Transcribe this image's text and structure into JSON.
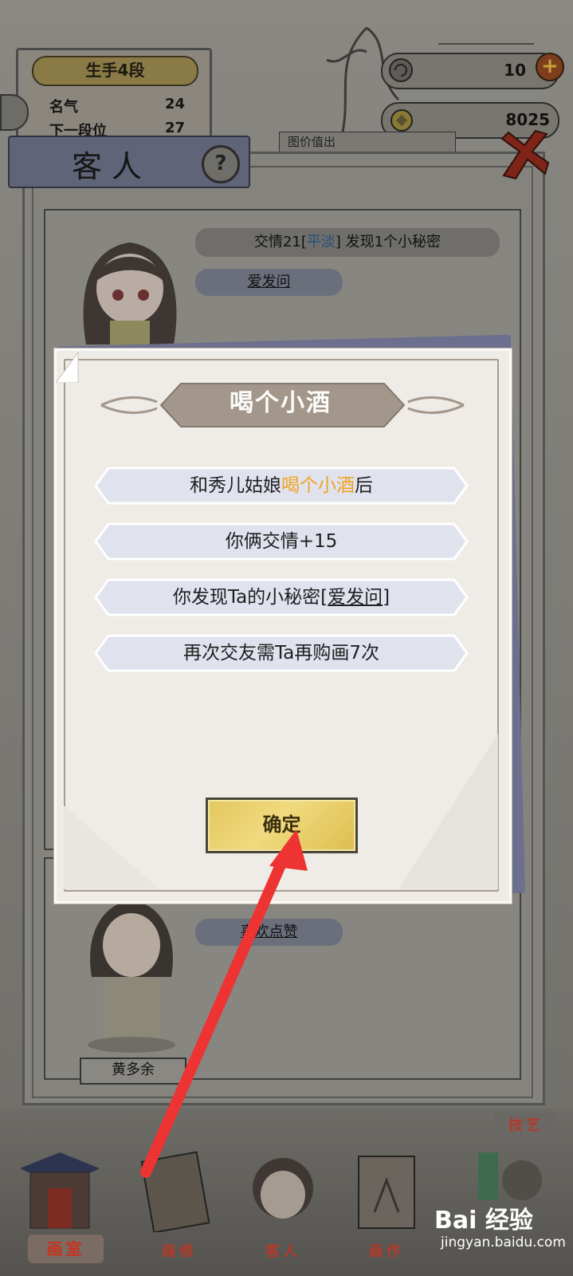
{
  "rank": {
    "title": "生手4段",
    "fame_label": "名气",
    "fame_value": "24",
    "next_label": "下一段位",
    "next_value": "27"
  },
  "currency": {
    "tokens": "10",
    "coins": "8025",
    "notice": "图价值出"
  },
  "guest_panel": {
    "title": "客人",
    "help_glyph": "?",
    "guests": [
      {
        "relation_prefix": "交情21[",
        "relation_status": "平淡",
        "relation_suffix": "] 发现1个小秘密",
        "tag": "爱发问"
      },
      {
        "tag": "喜欢点赞",
        "name": "黄多余"
      }
    ]
  },
  "dialog": {
    "title": "喝个小酒",
    "row1_prefix": "和秀儿姑娘",
    "row1_highlight": "喝个小酒",
    "row1_suffix": "后",
    "row2": "你俩交情+15",
    "row3_prefix": "你发现Ta的小秘密[",
    "row3_link": "爱发问",
    "row3_suffix": "]",
    "row4": "再次交友需Ta再购画7次",
    "confirm_label": "确定"
  },
  "bottom_nav": {
    "items": [
      "画室",
      "装修",
      "客人",
      "画作",
      "技艺"
    ]
  },
  "watermark": {
    "main": "Bai 经验",
    "sub": "jingyan.baidu.com"
  },
  "colors": {
    "highlight": "#f0a321",
    "status_blue": "#2a6fb8",
    "arrow": "#ee3333",
    "button_gold": "#e3c75e"
  }
}
